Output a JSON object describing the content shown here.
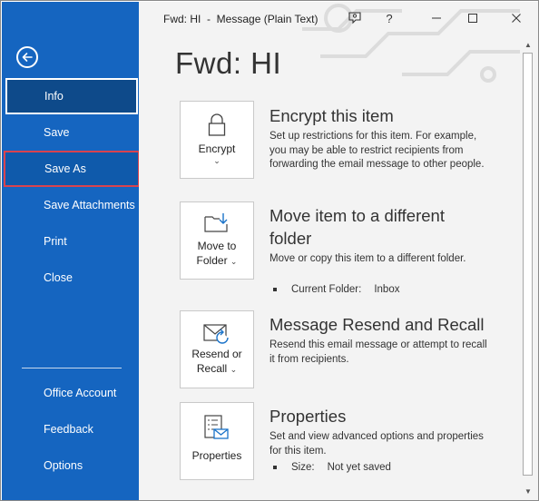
{
  "window": {
    "title": "Fwd: HI  -  Message (Plain Text)",
    "help_label": "?"
  },
  "sidebar": {
    "items": [
      {
        "label": "Info"
      },
      {
        "label": "Save"
      },
      {
        "label": "Save As"
      },
      {
        "label": "Save Attachments"
      },
      {
        "label": "Print"
      },
      {
        "label": "Close"
      },
      {
        "label": "Office Account"
      },
      {
        "label": "Feedback"
      },
      {
        "label": "Options"
      }
    ]
  },
  "main": {
    "page_title": "Fwd: HI",
    "sections": [
      {
        "button_label_1": "Encrypt",
        "title": "Encrypt this item",
        "description": "Set up restrictions for this item. For example, you may be able to restrict recipients from forwarding the email message to other people.",
        "icon": "lock-icon"
      },
      {
        "button_label_1": "Move to",
        "button_label_2": "Folder",
        "title": "Move item to a different folder",
        "description": "Move or copy this item to a different folder.",
        "bullet_label": "Current Folder:",
        "bullet_value": "Inbox",
        "icon": "folder-arrow-icon"
      },
      {
        "button_label_1": "Resend or",
        "button_label_2": "Recall",
        "title": "Message Resend and Recall",
        "description": "Resend this email message or attempt to recall it from recipients.",
        "icon": "envelope-refresh-icon"
      },
      {
        "button_label_1": "Properties",
        "title": "Properties",
        "description": "Set and view advanced options and properties for this item.",
        "bullet_label": "Size:",
        "bullet_value": "Not yet saved",
        "icon": "properties-icon"
      }
    ]
  },
  "colors": {
    "sidebar_bg": "#1565c0",
    "sidebar_active": "#0e4a8a",
    "highlight_border": "#d9434e",
    "main_bg": "#f3f3f3"
  }
}
